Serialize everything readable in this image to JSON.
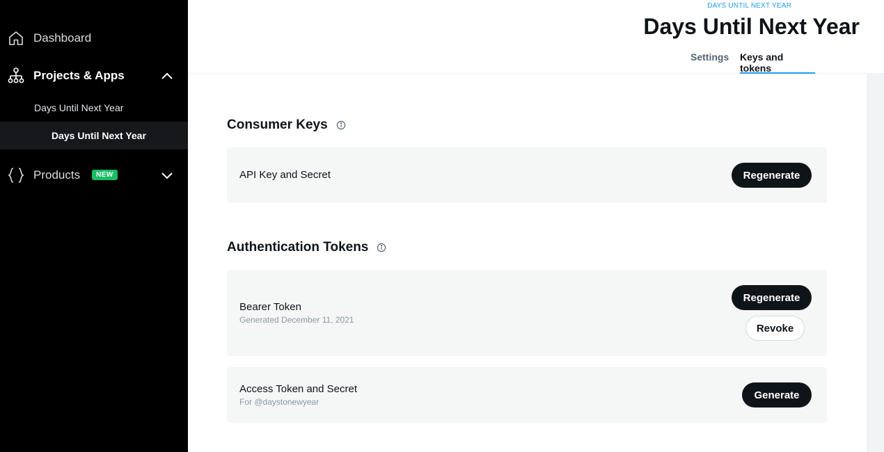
{
  "sidebar": {
    "dashboard_label": "Dashboard",
    "projects_label": "Projects & Apps",
    "project_name": "Days Until Next Year",
    "app_name": "Days Until Next Year",
    "products_label": "Products",
    "products_badge": "NEW"
  },
  "header": {
    "eyebrow": "DAYS UNTIL NEXT YEAR",
    "title": "Days Until Next Year",
    "tabs": [
      {
        "label": "Settings",
        "active": false
      },
      {
        "label": "Keys and tokens",
        "active": true
      }
    ]
  },
  "consumer_keys": {
    "title": "Consumer Keys",
    "api_key": {
      "label": "API Key and Secret",
      "button": "Regenerate"
    }
  },
  "auth_tokens": {
    "title": "Authentication Tokens",
    "bearer": {
      "label": "Bearer Token",
      "sub": "Generated December 11, 2021",
      "regenerate_button": "Regenerate",
      "revoke_button": "Revoke"
    },
    "access": {
      "label": "Access Token and Secret",
      "sub": "For @daystonewyear",
      "button": "Generate"
    }
  },
  "colors": {
    "accent": "#1d9bf0",
    "badge_green": "#17bf63",
    "button_dark": "#0f1419"
  }
}
